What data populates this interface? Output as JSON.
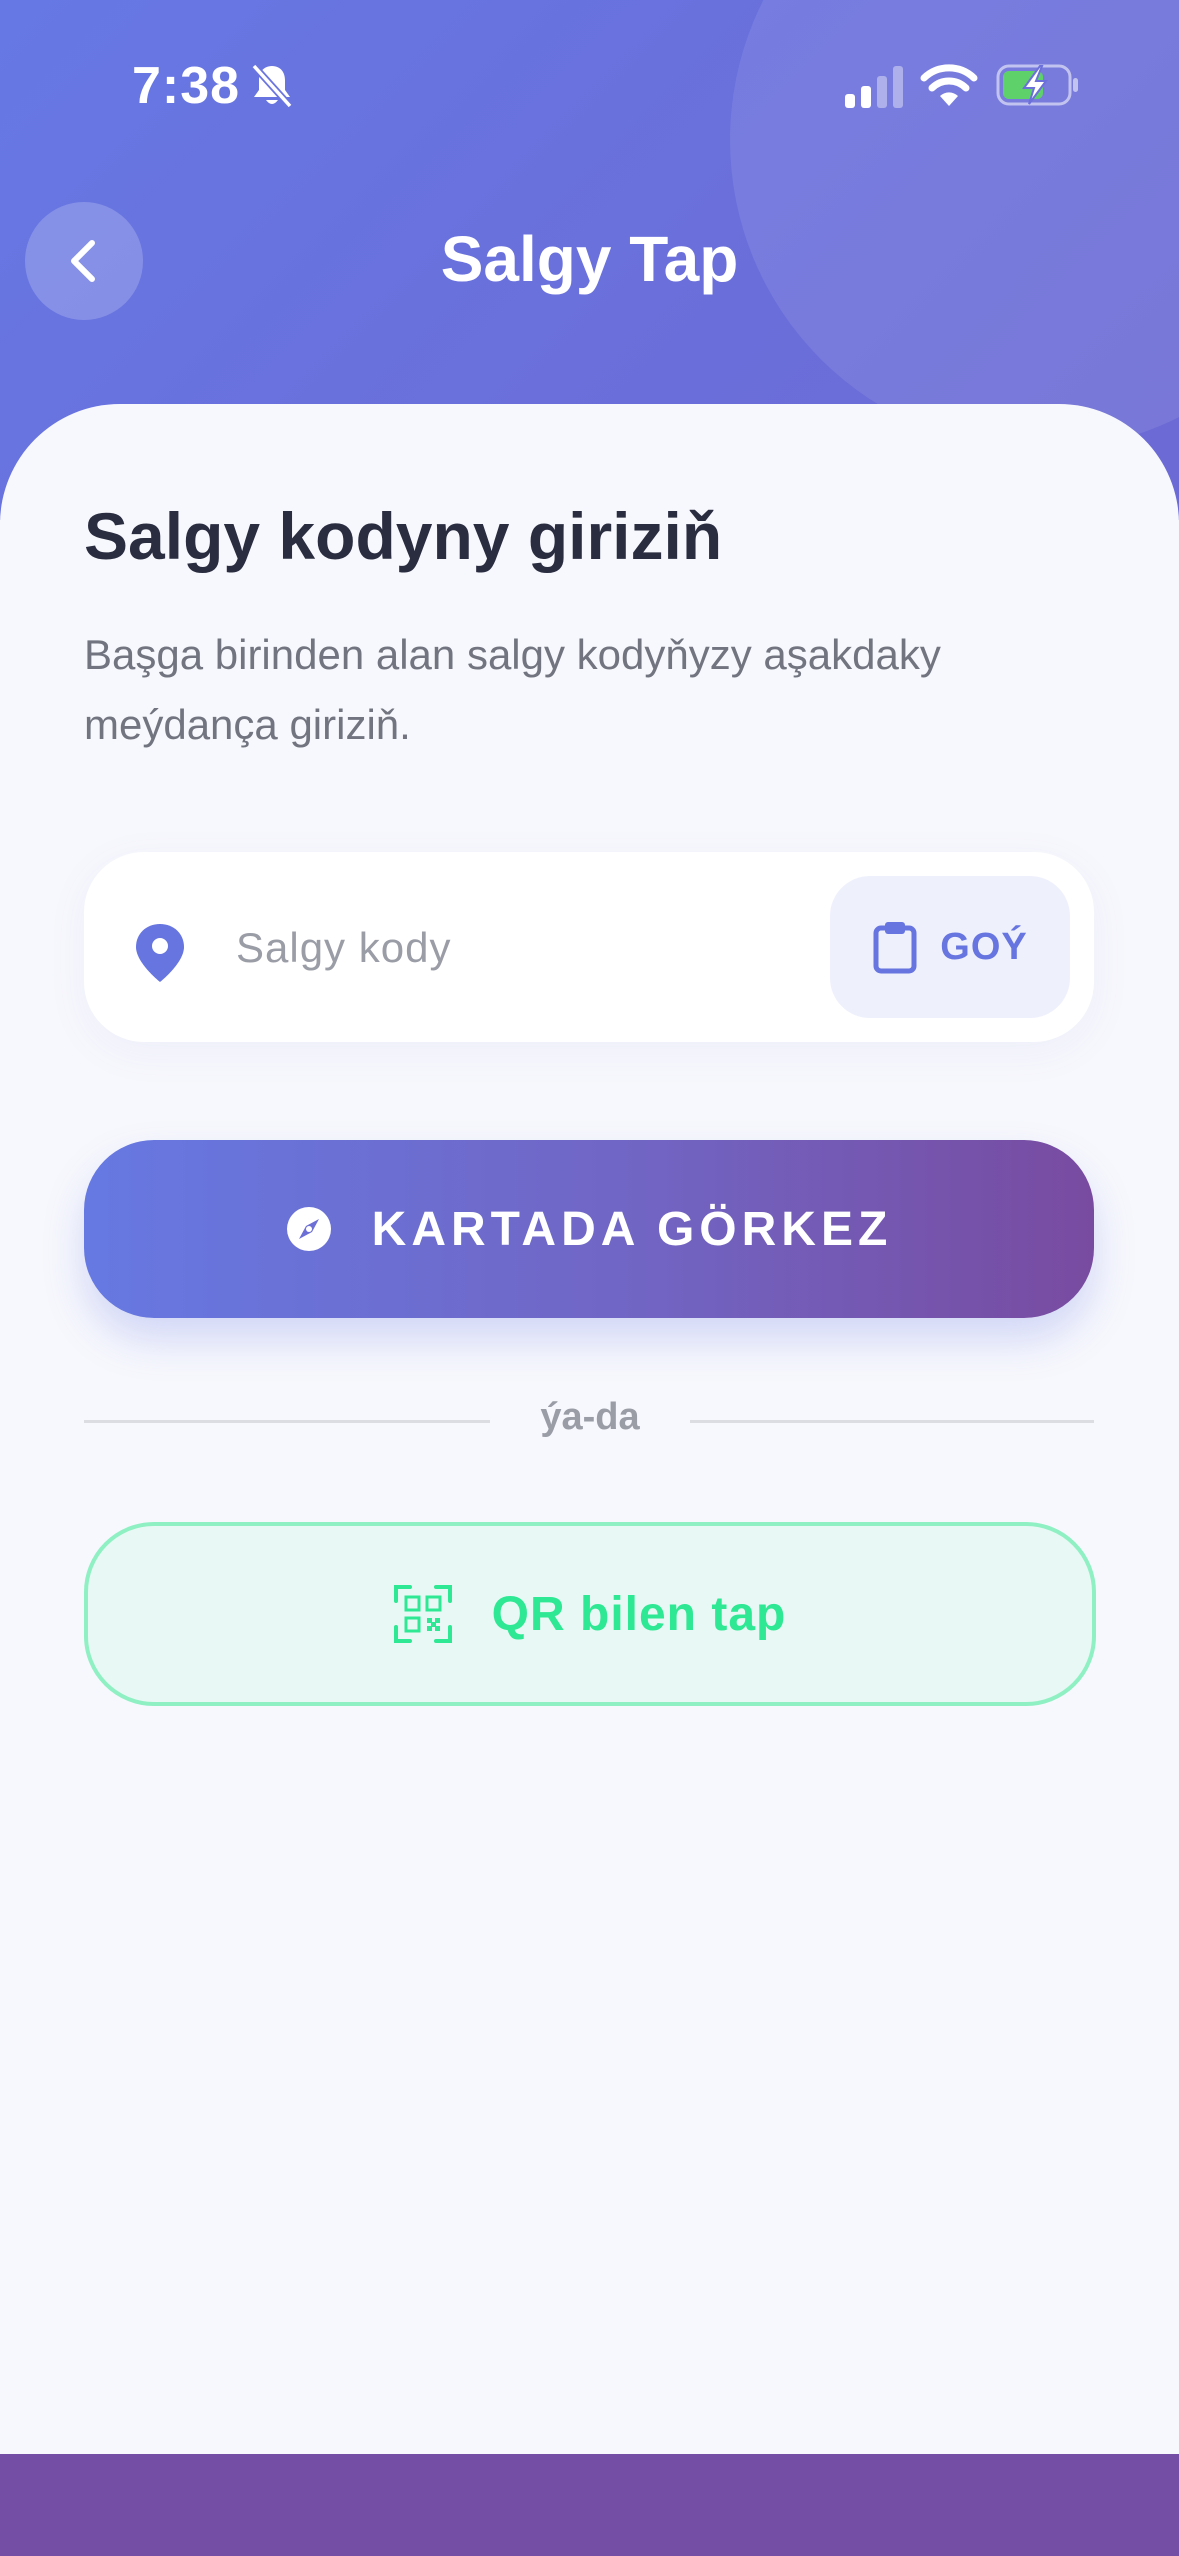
{
  "status_bar": {
    "time": "7:38"
  },
  "header": {
    "title": "Salgy Tap"
  },
  "content": {
    "heading": "Salgy kodyny giriziň",
    "description": "Başga birinden alan salgy kodyňyzy aşakdaky meýdança giriziň."
  },
  "code_input": {
    "placeholder": "Salgy kody",
    "value": "",
    "paste_label": "GOÝ"
  },
  "map_button": {
    "label": "KARTADA GÖRKEZ"
  },
  "divider": {
    "text": "ýa-da"
  },
  "qr_button": {
    "label": "QR bilen tap"
  },
  "colors": {
    "header_gradient_start": "#6678e4",
    "header_gradient_end": "#6c6ad4",
    "accent": "#6675e0",
    "primary_button_start": "#6679e2",
    "primary_button_end": "#784ba0",
    "qr_green": "#2ee893",
    "qr_border": "#8ff0c3",
    "heading_text": "#2a2d40",
    "bottom_bar": "#734ea4"
  },
  "icons": {
    "back": "chevron-left-icon",
    "silent": "bell-off-icon",
    "signal": "cellular-signal-icon",
    "wifi": "wifi-icon",
    "battery": "battery-charging-icon",
    "location": "location-pin-icon",
    "paste": "clipboard-icon",
    "map": "compass-icon",
    "qr": "qr-scan-icon"
  }
}
